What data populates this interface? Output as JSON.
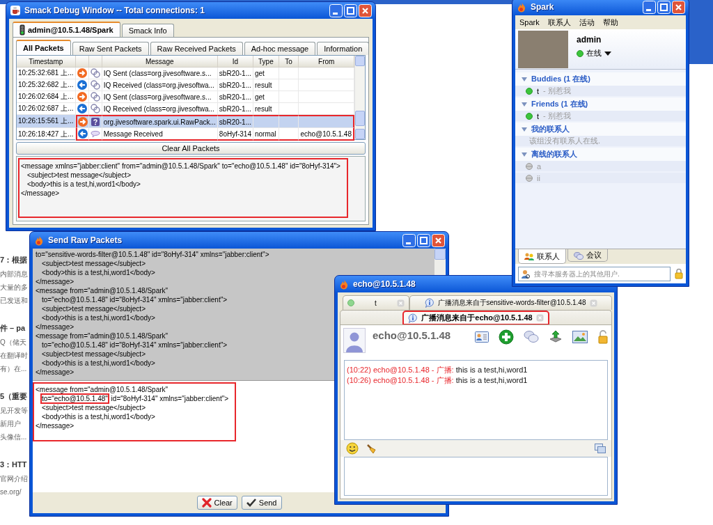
{
  "background_page": {
    "sections": [
      {
        "heading": "7：根据",
        "lines": [
          "内部消息",
          "大量的多",
          "已发送和"
        ]
      },
      {
        "heading": "件 – pa",
        "lines": [
          "Q（储天",
          "在翻译时",
          "有）在..."
        ]
      },
      {
        "heading": "5（重要",
        "lines": [
          "见开发等",
          "新用户",
          "头像信..."
        ]
      },
      {
        "heading": "3：HTT",
        "lines": [
          "官网介绍",
          "se.org/"
        ]
      }
    ]
  },
  "smack_window": {
    "title": "Smack Debug Window -- Total connections: 1",
    "connection_tabs": [
      {
        "label": "admin@10.5.1.48/Spark",
        "kind": "connection",
        "selected": true
      },
      {
        "label": "Smack Info",
        "kind": "info",
        "selected": false
      }
    ],
    "packet_tabs": [
      {
        "label": "All Packets",
        "selected": true
      },
      {
        "label": "Raw Sent Packets",
        "selected": false
      },
      {
        "label": "Raw Received Packets",
        "selected": false
      },
      {
        "label": "Ad-hoc message",
        "selected": false
      },
      {
        "label": "Information",
        "selected": false
      }
    ],
    "table": {
      "columns": [
        "Timestamp",
        "Message",
        "Id",
        "Type",
        "To",
        "From"
      ],
      "rows": [
        {
          "timestamp": "10:25:32:681 上...",
          "direction": {
            "kind": "sent"
          },
          "packet": {
            "kind": "iq"
          },
          "message": "IQ Sent (class=org.jivesoftware.s...",
          "id": "sbR20-1...",
          "type": "get",
          "selected": false,
          "highlighted": false
        },
        {
          "timestamp": "10:25:32:682 上...",
          "direction": {
            "kind": "received"
          },
          "packet": {
            "kind": "iq"
          },
          "message": "IQ Received (class=org.jivesoftwa...",
          "id": "sbR20-1...",
          "type": "result",
          "selected": false,
          "highlighted": false
        },
        {
          "timestamp": "10:26:02:684 上...",
          "direction": {
            "kind": "sent"
          },
          "packet": {
            "kind": "iq"
          },
          "message": "IQ Sent (class=org.jivesoftware.s...",
          "id": "sbR20-1...",
          "type": "get",
          "selected": false,
          "highlighted": false
        },
        {
          "timestamp": "10:26:02:687 上...",
          "direction": {
            "kind": "received"
          },
          "packet": {
            "kind": "iq"
          },
          "message": "IQ Received (class=org.jivesoftwa...",
          "id": "sbR20-1...",
          "type": "result",
          "selected": false,
          "highlighted": false
        },
        {
          "timestamp": "10:26:15:561 上...",
          "direction": {
            "kind": "sent"
          },
          "packet": {
            "kind": "raw"
          },
          "message": "org.jivesoftware.spark.ui.RawPack...",
          "id": "sbR20-1...",
          "selected": true,
          "highlighted": true
        },
        {
          "timestamp": "10:26:18:427 上...",
          "direction": {
            "kind": "received"
          },
          "packet": {
            "kind": "message"
          },
          "message": "Message Received",
          "id": "8oHyf-314",
          "type": "normal",
          "from": "echo@10.5.1.48",
          "selected": false,
          "highlighted": true
        }
      ]
    },
    "clear_button": "Clear All Packets",
    "packet_detail": {
      "highlighted": true,
      "open": [
        "<message xmlns=\"jabber:client\" from=\"admin@10.5.1.48/Spark\" to=\"echo@10.5.1.48\" id=\"8oHyf-314\">"
      ],
      "children": [
        "<subject>test message</subject>",
        "<body>this is a test,hi,word1</body>"
      ],
      "close": "</message>"
    }
  },
  "spark_window": {
    "title": "Spark",
    "menu": [
      "Spark",
      "联系人",
      "活动",
      "帮助"
    ],
    "profile": {
      "name": "admin",
      "status": "在线",
      "online": true
    },
    "groups": [
      {
        "name": "Buddies (1 在线)",
        "expanded": true,
        "contacts": [
          {
            "name": "t",
            "status": "- 别惹我",
            "online": true
          }
        ]
      },
      {
        "name": "Friends (1 在线)",
        "expanded": true,
        "contacts": [
          {
            "name": "t",
            "status": "- 别惹我",
            "online": true
          }
        ]
      },
      {
        "name": "我的联系人",
        "expanded": true,
        "empty_note": "该组没有联系人在线."
      },
      {
        "name": "离线的联系人",
        "expanded": true,
        "contacts": [
          {
            "name": "a",
            "online": false
          },
          {
            "name": "ii",
            "online": false
          }
        ]
      }
    ],
    "bottom_tabs": [
      {
        "label": "联系人",
        "kind": "contacts",
        "selected": true
      },
      {
        "label": "会议",
        "kind": "conferences",
        "selected": false
      }
    ],
    "search": {
      "placeholder": "搜寻本服务器上的其他用户."
    }
  },
  "raw_window": {
    "title": "Send Raw Packets",
    "log": [
      {
        "open": [
          "to=\"sensitive-words-filter@10.5.1.48\" id=\"8oHyf-314\" xmlns=\"jabber:client\">"
        ],
        "children": [
          "<subject>test message</subject>",
          "<body>this is a test,hi,word1</body>"
        ],
        "close": "</message>"
      },
      {
        "open": [
          "<message from=\"admin@10.5.1.48/Spark\"",
          "to=\"echo@10.5.1.48\" id=\"8oHyf-314\" xmlns=\"jabber:client\">"
        ],
        "children": [
          "<subject>test message</subject>",
          "<body>this is a test,hi,word1</body>"
        ],
        "close": "</message>"
      },
      {
        "open": [
          "<message from=\"admin@10.5.1.48/Spark\"",
          "to=\"echo@10.5.1.48\" id=\"8oHyf-314\" xmlns=\"jabber:client\">"
        ],
        "children": [
          "<subject>test message</subject>",
          "<body>this is a test,hi,word1</body>"
        ],
        "close": "</message>"
      }
    ],
    "input": {
      "highlighted": true,
      "open": [
        "<message from=\"admin@10.5.1.48/Spark\"",
        {
          "marked": "to=\"echo@10.5.1.48\"",
          "rest": " id=\"8oHyf-314\" xmlns=\"jabber:client\">"
        }
      ],
      "children": [
        "<subject>test message</subject>",
        "<body>this is a test,hi,word1</body>"
      ],
      "close": "</message>"
    },
    "buttons": [
      {
        "label": "Clear",
        "kind": "clear"
      },
      {
        "label": "Send",
        "kind": "send"
      }
    ]
  },
  "echo_window": {
    "title": "echo@10.5.1.48",
    "tab_rows": [
      {
        "tabs": [
          {
            "label": "t",
            "kind": "contact",
            "selected": false,
            "highlighted": false
          },
          {
            "label": "广播消息来自于sensitive-words-filter@10.5.1.48",
            "kind": "broadcast",
            "selected": false,
            "highlighted": false
          }
        ]
      },
      {
        "tabs": [
          {
            "label": "广播消息来自于echo@10.5.1.48",
            "kind": "broadcast",
            "selected": true,
            "highlighted": true
          }
        ]
      }
    ],
    "contact": "echo@10.5.1.48",
    "messages": [
      {
        "time": "(10:22)",
        "sender": "echo@10.5.1.48 - 广播:",
        "text": "this is a test,hi,word1"
      },
      {
        "time": "(10:26)",
        "sender": "echo@10.5.1.48 - 广播:",
        "text": "this is a test,hi,word1"
      }
    ]
  }
}
